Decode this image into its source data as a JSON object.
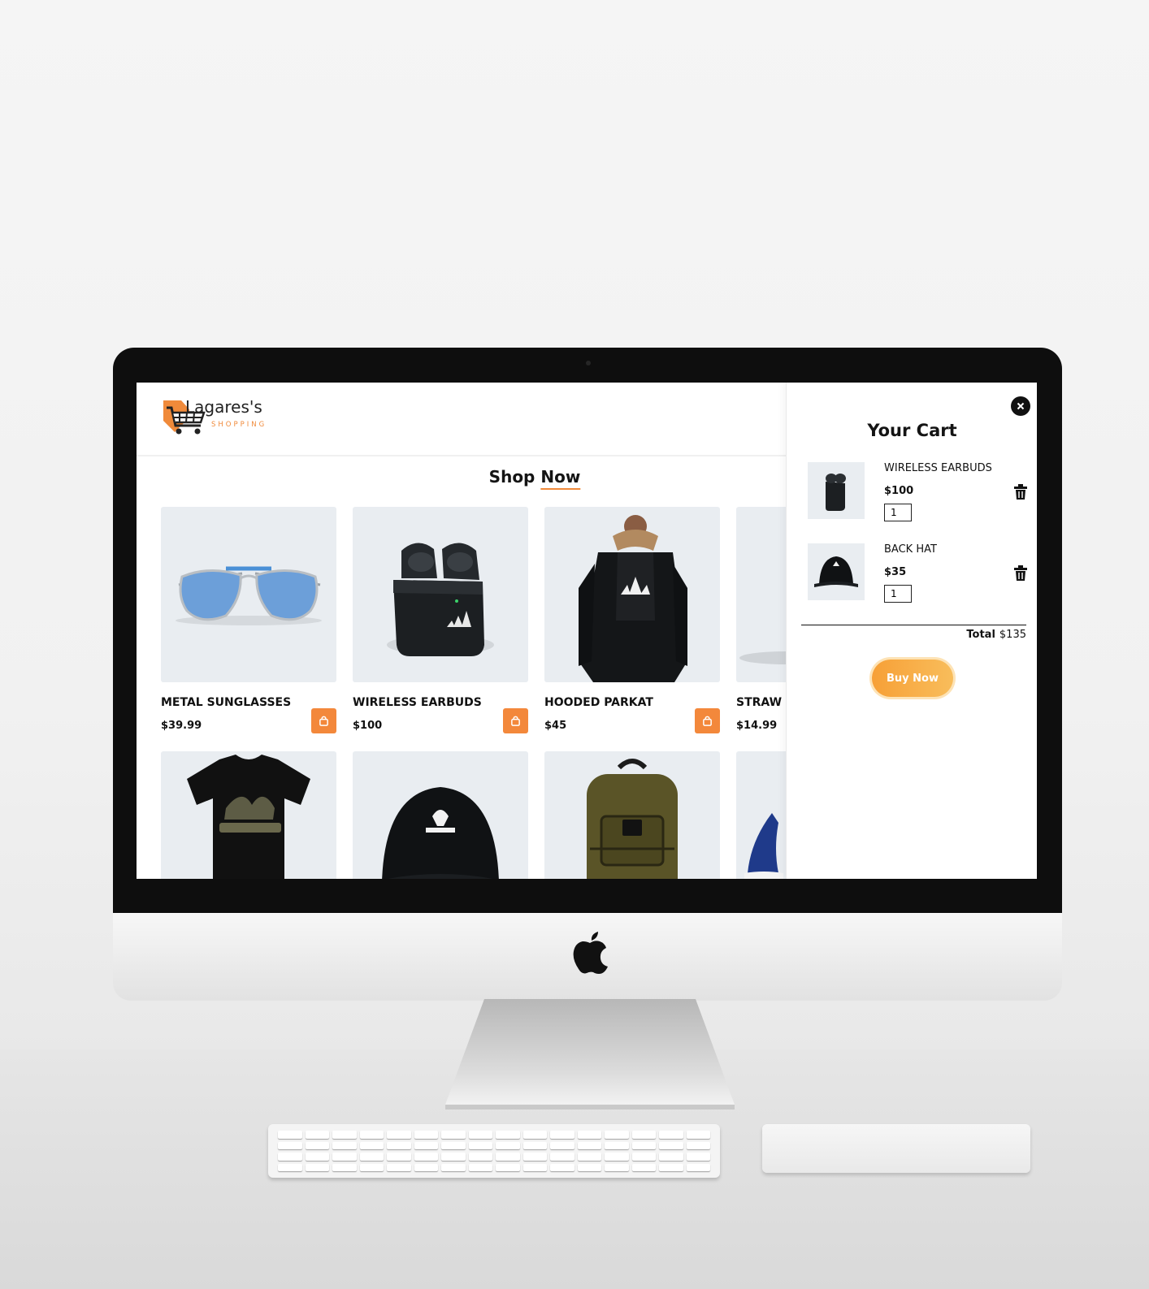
{
  "logo": {
    "name": "Lagares's",
    "sub": "SHOPPING"
  },
  "shop": {
    "title_a": "Shop",
    "title_b": "Now"
  },
  "products": [
    {
      "name": "METAL SUNGLASSES",
      "price": "$39.99",
      "image": "sunglasses-image"
    },
    {
      "name": "WIRELESS EARBUDS",
      "price": "$100",
      "image": "earbuds-image"
    },
    {
      "name": "HOODED PARKAT",
      "price": "$45",
      "image": "parka-image"
    },
    {
      "name": "STRAW",
      "price": "$14.99",
      "image": "straw-hat-image"
    },
    {
      "name": "",
      "price": "",
      "image": "tshirt-image"
    },
    {
      "name": "",
      "price": "",
      "image": "cap-image"
    },
    {
      "name": "",
      "price": "",
      "image": "backpack-image"
    },
    {
      "name": "",
      "price": "",
      "image": "sneaker-image"
    }
  ],
  "cart": {
    "title": "Your Cart",
    "items": [
      {
        "name": "WIRELESS EARBUDS",
        "price": "$100",
        "qty": "1"
      },
      {
        "name": "BACK HAT",
        "price": "$35",
        "qty": "1"
      }
    ],
    "total_label": "Total",
    "total_value": "$135",
    "buy_label": "Buy Now"
  },
  "colors": {
    "accent": "#f3883b",
    "card_bg": "#e9edf1",
    "buy_start": "#f7a037",
    "buy_end": "#f8bd5b"
  }
}
